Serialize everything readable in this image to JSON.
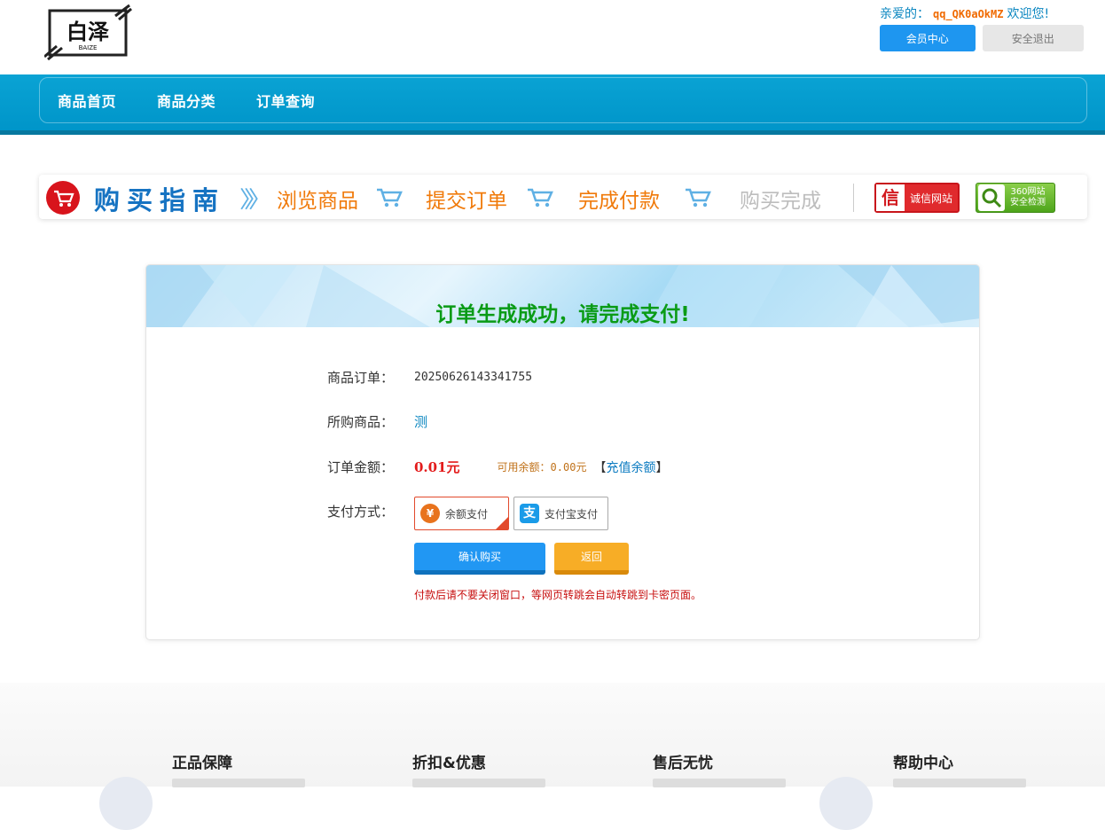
{
  "header": {
    "logo_text": "白泽",
    "logo_sub": "BAIZE",
    "greeting_prefix": "亲爱的：",
    "username": "qq_QK0aOkMZ",
    "greeting_suffix": "欢迎您!",
    "member_center": "会员中心",
    "logout": "安全退出"
  },
  "nav": {
    "items": [
      "商品首页",
      "商品分类",
      "订单查询"
    ]
  },
  "guide": {
    "title": "购买指南",
    "steps": [
      "浏览商品",
      "提交订单",
      "完成付款",
      "购买完成"
    ],
    "badge_trust": "诚信网站",
    "badge_trust_icon": "信",
    "badge_360_line1": "360网站",
    "badge_360_line2": "安全检测"
  },
  "order": {
    "title": "订单生成成功，请完成支付!",
    "order_no_label": "商品订单：",
    "order_no": "20250626143341755",
    "product_label": "所购商品：",
    "product": "测",
    "amount_label": "订单金额：",
    "amount": "0.01元",
    "balance": "可用余额：0.00元",
    "recharge_open": "【",
    "recharge": "充值余额",
    "recharge_close": "】",
    "pay_label": "支付方式：",
    "pay_options": [
      "余额支付",
      "支付宝支付"
    ],
    "pay_selected": "余额支付",
    "confirm": "确认购买",
    "back": "返回",
    "notice": "付款后请不要关闭窗口，等网页转跳会自动转跳到卡密页面。"
  },
  "footer": {
    "columns": [
      "正品保障",
      "折扣&优惠",
      "售后无忧",
      "帮助中心"
    ]
  },
  "colors": {
    "primary": "#1e96f0",
    "nav": "#0aa3d4",
    "success_title": "#0a9b16",
    "amount": "#e31b1b",
    "step": "#f07a0a"
  }
}
